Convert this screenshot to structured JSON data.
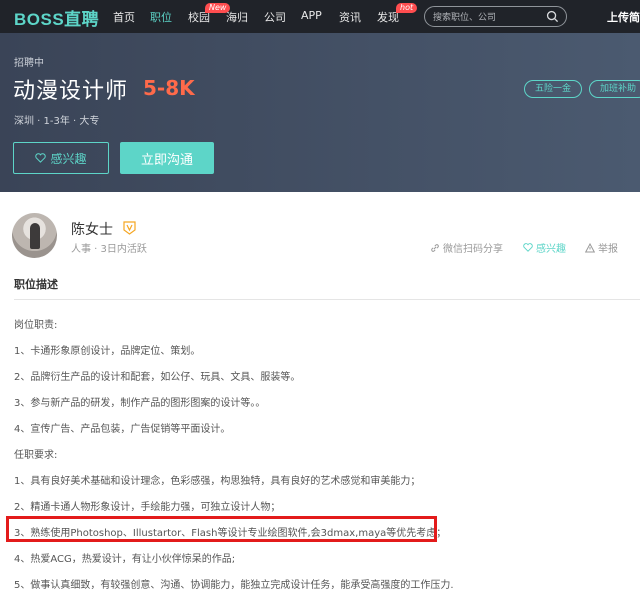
{
  "nav": {
    "logo": "BOSS直聘",
    "items": [
      "首页",
      "职位",
      "校园",
      "海归",
      "公司",
      "APP",
      "资讯",
      "发现"
    ],
    "badge_new": "New",
    "badge_hot": "hot",
    "search_placeholder": "搜索职位、公司",
    "upload": "上传简"
  },
  "job": {
    "status": "招聘中",
    "title": "动漫设计师",
    "salary": "5-8K",
    "meta": "深圳 · 1-3年 · 大专",
    "welfare": [
      "五险一金",
      "加班补助"
    ],
    "interest_button": "感兴趣",
    "chat_button": "立即沟通"
  },
  "recruiter": {
    "name": "陈女士",
    "title": "人事 · 3日内活跃",
    "share": "微信扫码分享",
    "interest": "感兴趣",
    "report": "举报"
  },
  "description": {
    "section_title": "职位描述",
    "lines": [
      "岗位职责:",
      "1、卡通形象原创设计，品牌定位、策划。",
      "2、品牌衍生产品的设计和配套，如公仔、玩具、文具、服装等。",
      "3、参与新产品的研发，制作产品的图形图案的设计等。。",
      "4、宣传广告、产品包装，广告促销等平面设计。",
      "任职要求:",
      "1、具有良好美术基础和设计理念，色彩感强，构思独特，具有良好的艺术感觉和审美能力；",
      "2、精通卡通人物形象设计，手绘能力强，可独立设计人物；",
      "3、熟练使用Photoshop、Illustartor、Flash等设计专业绘图软件,会3dmax,maya等优先考虑；",
      "4、热爱ACG，热爱设计，有让小伙伴惊呆的作品;",
      "5、做事认真细致，有较强创意、沟通、协调能力，能独立完成设计任务，能承受高强度的工作压力."
    ]
  },
  "colors": {
    "accent": "#5dd5c8",
    "salary": "#ff6a4a",
    "highlight": "#e31b1b",
    "nav_bg": "#202329"
  }
}
